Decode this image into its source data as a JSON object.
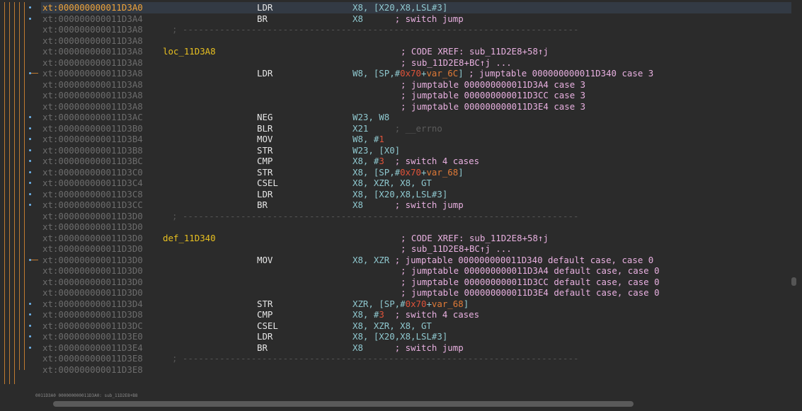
{
  "lines": [
    {
      "addr": "xt:000000000011D3A0",
      "label": "",
      "mnem": "LDR",
      "ops_html": "X8, [X20,X8,LSL#3]",
      "current": true,
      "hl": true
    },
    {
      "addr": "xt:000000000011D3A4",
      "label": "",
      "mnem": "BR",
      "ops_html": "X8      <span class='cmt'>; switch jump</span>"
    },
    {
      "addr": "xt:000000000011D3A8",
      "sep": true
    },
    {
      "addr": "xt:000000000011D3A8"
    },
    {
      "addr": "xt:000000000011D3A8",
      "label": "loc_11D3A8",
      "xref": "; CODE XREF: sub_11D2E8+58↑j"
    },
    {
      "addr": "xt:000000000011D3A8",
      "xref": "; sub_11D2E8+BC↑j ..."
    },
    {
      "addr": "xt:000000000011D3A8",
      "mnem": "LDR",
      "ops_html": "W8, [SP,#<span class='hexnum'>0x70</span>+<span class='var'>var_6C</span>] <span class='cmt'>; jumptable 000000000011D340 case 3</span>"
    },
    {
      "addr": "xt:000000000011D3A8",
      "xref": "; jumptable 000000000011D3A4 case 3"
    },
    {
      "addr": "xt:000000000011D3A8",
      "xref": "; jumptable 000000000011D3CC case 3"
    },
    {
      "addr": "xt:000000000011D3A8",
      "xref": "; jumptable 000000000011D3E4 case 3"
    },
    {
      "addr": "xt:000000000011D3AC",
      "mnem": "NEG",
      "ops_html": "W23, W8"
    },
    {
      "addr": "xt:000000000011D3B0",
      "mnem": "BLR",
      "ops_html": "X21     <span class='cmt gray'>; __errno</span>"
    },
    {
      "addr": "xt:000000000011D3B4",
      "mnem": "MOV",
      "ops_html": "W8, #<span class='hexnum'>1</span>"
    },
    {
      "addr": "xt:000000000011D3B8",
      "mnem": "STR",
      "ops_html": "W23, [X0]"
    },
    {
      "addr": "xt:000000000011D3BC",
      "mnem": "CMP",
      "ops_html": "X8, #<span class='hexnum'>3</span>  <span class='cmt'>; switch 4 cases</span>"
    },
    {
      "addr": "xt:000000000011D3C0",
      "mnem": "STR",
      "ops_html": "X8, [SP,#<span class='hexnum'>0x70</span>+<span class='var'>var_68</span>]"
    },
    {
      "addr": "xt:000000000011D3C4",
      "mnem": "CSEL",
      "ops_html": "X8, XZR, X8, GT"
    },
    {
      "addr": "xt:000000000011D3C8",
      "mnem": "LDR",
      "ops_html": "X8, [X20,X8,LSL#3]"
    },
    {
      "addr": "xt:000000000011D3CC",
      "mnem": "BR",
      "ops_html": "X8      <span class='cmt'>; switch jump</span>"
    },
    {
      "addr": "xt:000000000011D3D0",
      "sep": true
    },
    {
      "addr": "xt:000000000011D3D0"
    },
    {
      "addr": "xt:000000000011D3D0",
      "label": "def_11D340",
      "xref": "; CODE XREF: sub_11D2E8+58↑j"
    },
    {
      "addr": "xt:000000000011D3D0",
      "xref": "; sub_11D2E8+BC↑j ..."
    },
    {
      "addr": "xt:000000000011D3D0",
      "mnem": "MOV",
      "ops_html": "X8, XZR <span class='cmt'>; jumptable 000000000011D340 default case, case 0</span>"
    },
    {
      "addr": "xt:000000000011D3D0",
      "xref": "; jumptable 000000000011D3A4 default case, case 0"
    },
    {
      "addr": "xt:000000000011D3D0",
      "xref": "; jumptable 000000000011D3CC default case, case 0"
    },
    {
      "addr": "xt:000000000011D3D0",
      "xref": "; jumptable 000000000011D3E4 default case, case 0"
    },
    {
      "addr": "xt:000000000011D3D4",
      "mnem": "STR",
      "ops_html": "XZR, [SP,#<span class='hexnum'>0x70</span>+<span class='var'>var_68</span>]"
    },
    {
      "addr": "xt:000000000011D3D8",
      "mnem": "CMP",
      "ops_html": "X8, #<span class='hexnum'>3</span>  <span class='cmt'>; switch 4 cases</span>"
    },
    {
      "addr": "xt:000000000011D3DC",
      "mnem": "CSEL",
      "ops_html": "X8, XZR, X8, GT"
    },
    {
      "addr": "xt:000000000011D3E0",
      "mnem": "LDR",
      "ops_html": "X8, [X20,X8,LSL#3]"
    },
    {
      "addr": "xt:000000000011D3E4",
      "mnem": "BR",
      "ops_html": "X8      <span class='cmt'>; switch jump</span>"
    },
    {
      "addr": "xt:000000000011D3E8",
      "sep": true
    },
    {
      "addr": "xt:000000000011D3E8"
    }
  ],
  "status": "0011D3A0 000000000011D3A0: sub_11D2E8+B8",
  "colors": {
    "background": "#2b2b2b",
    "address": "#6d6d6d",
    "label": "#e8c020",
    "comment": "#e8b0e0",
    "arrow": "#c07a30"
  }
}
